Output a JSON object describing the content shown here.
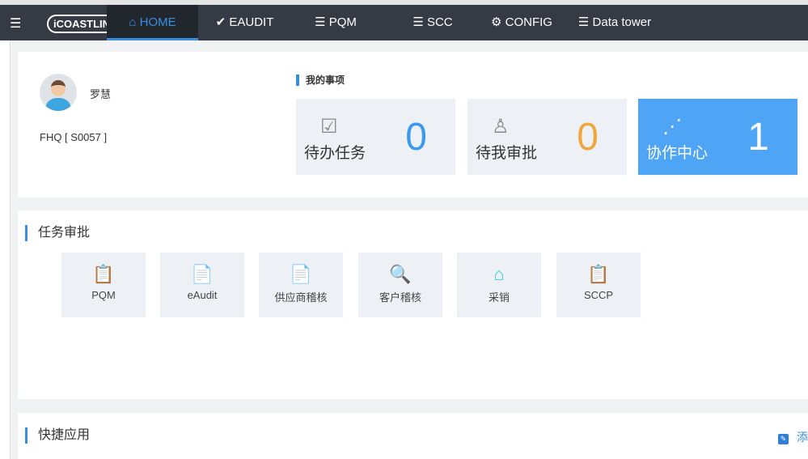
{
  "nav": {
    "logo": "iCOASTLINE",
    "items": [
      {
        "label": "HOME",
        "icon": "home-icon",
        "glyph": "⌂",
        "active": true
      },
      {
        "label": "EAUDIT",
        "icon": "check-icon",
        "glyph": "✔"
      },
      {
        "label": "PQM",
        "icon": "list-icon",
        "glyph": "☰"
      },
      {
        "label": "SCC",
        "icon": "list-icon",
        "glyph": "☰"
      },
      {
        "label": "CONFIG",
        "icon": "gears-icon",
        "glyph": "⚙"
      },
      {
        "label": "Data tower",
        "icon": "list-icon",
        "glyph": "☰"
      }
    ]
  },
  "user": {
    "name": "罗慧",
    "code": "FHQ [ S0057 ]"
  },
  "my_items": {
    "title": "我的事项",
    "tiles": [
      {
        "label": "待办任务",
        "value": "0",
        "color": "#3b9af0",
        "icon": "clipboard-check-icon"
      },
      {
        "label": "待我审批",
        "value": "0",
        "color": "#f0a640",
        "icon": "user-check-icon"
      },
      {
        "label": "协作中心",
        "value": "1",
        "color": "#ffffff",
        "icon": "share-nodes-icon"
      }
    ]
  },
  "approval": {
    "title": "任务审批",
    "apps": [
      {
        "label": "PQM",
        "color": "#4a9be8",
        "icon": "clipboard-icon"
      },
      {
        "label": "eAudit",
        "color": "#f0a878",
        "icon": "document-minus-icon"
      },
      {
        "label": "供应商稽核",
        "color": "#e85a5a",
        "icon": "document-eye-icon"
      },
      {
        "label": "客户稽核",
        "color": "#e85a5a",
        "icon": "document-search-icon"
      },
      {
        "label": "采销",
        "color": "#3cc8d8",
        "icon": "house-icon"
      },
      {
        "label": "SCCP",
        "color": "#4a9be8",
        "icon": "clipboard-icon"
      }
    ]
  },
  "quick": {
    "title": "快捷应用",
    "add_label": "添"
  }
}
